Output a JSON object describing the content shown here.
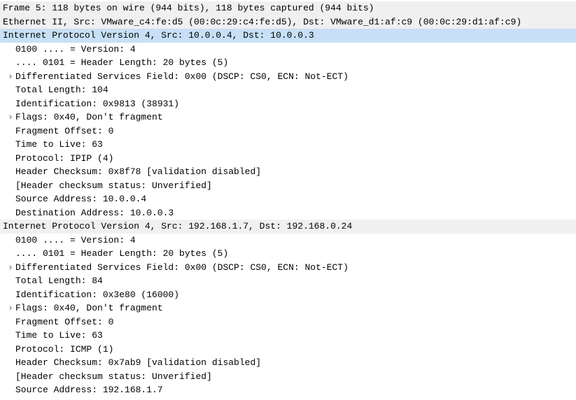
{
  "frame": {
    "summary": "Frame 5: 118 bytes on wire (944 bits), 118 bytes captured (944 bits)"
  },
  "ethernet": {
    "summary": "Ethernet II, Src: VMware_c4:fe:d5 (00:0c:29:c4:fe:d5), Dst: VMware_d1:af:c9 (00:0c:29:d1:af:c9)"
  },
  "ipv4_outer": {
    "summary": "Internet Protocol Version 4, Src: 10.0.0.4, Dst: 10.0.0.3",
    "version": "0100 .... = Version: 4",
    "header_length": ".... 0101 = Header Length: 20 bytes (5)",
    "dsf": "Differentiated Services Field: 0x00 (DSCP: CS0, ECN: Not-ECT)",
    "total_length": "Total Length: 104",
    "identification": "Identification: 0x9813 (38931)",
    "flags": "Flags: 0x40, Don't fragment",
    "fragment_offset": "Fragment Offset: 0",
    "ttl": "Time to Live: 63",
    "protocol": "Protocol: IPIP (4)",
    "checksum": "Header Checksum: 0x8f78 [validation disabled]",
    "checksum_status": "[Header checksum status: Unverified]",
    "src_addr": "Source Address: 10.0.0.4",
    "dst_addr": "Destination Address: 10.0.0.3"
  },
  "ipv4_inner": {
    "summary": "Internet Protocol Version 4, Src: 192.168.1.7, Dst: 192.168.0.24",
    "version": "0100 .... = Version: 4",
    "header_length": ".... 0101 = Header Length: 20 bytes (5)",
    "dsf": "Differentiated Services Field: 0x00 (DSCP: CS0, ECN: Not-ECT)",
    "total_length": "Total Length: 84",
    "identification": "Identification: 0x3e80 (16000)",
    "flags": "Flags: 0x40, Don't fragment",
    "fragment_offset": "Fragment Offset: 0",
    "ttl": "Time to Live: 63",
    "protocol": "Protocol: ICMP (1)",
    "checksum": "Header Checksum: 0x7ab9 [validation disabled]",
    "checksum_status": "[Header checksum status: Unverified]",
    "src_addr": "Source Address: 192.168.1.7"
  },
  "expander": "›"
}
